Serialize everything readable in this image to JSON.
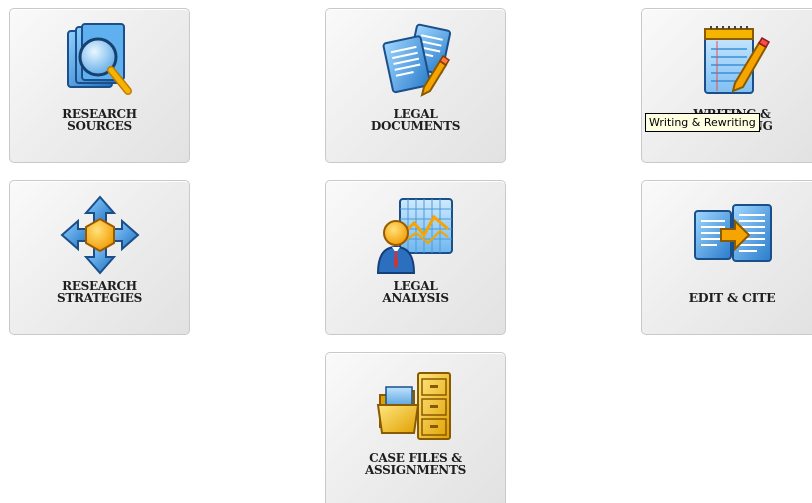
{
  "tiles": {
    "research_sources": {
      "label": "RESEARCH\nSOURCES",
      "icon": "magnifier-books-icon"
    },
    "legal_documents": {
      "label": "LEGAL\nDOCUMENTS",
      "icon": "documents-pen-icon"
    },
    "writing": {
      "label": "WRITING &\nREWRITING",
      "icon": "notepad-pencil-icon"
    },
    "research_strategies": {
      "label": "RESEARCH\nSTRATEGIES",
      "icon": "directional-arrows-icon"
    },
    "legal_analysis": {
      "label": "LEGAL\nANALYSIS",
      "icon": "person-chart-icon"
    },
    "edit_cite": {
      "label": "EDIT & CITE",
      "icon": "document-transfer-icon"
    },
    "case_files": {
      "label": "CASE FILES &\nASSIGNMENTS",
      "icon": "folder-cabinet-icon"
    }
  },
  "tooltip": {
    "text": "Writing & Rewriting"
  },
  "colors": {
    "tile_border": "#c9c9c9",
    "tooltip_bg": "#ffffe1",
    "icon_blue": "#3a8fd8",
    "icon_orange": "#f5a400"
  }
}
